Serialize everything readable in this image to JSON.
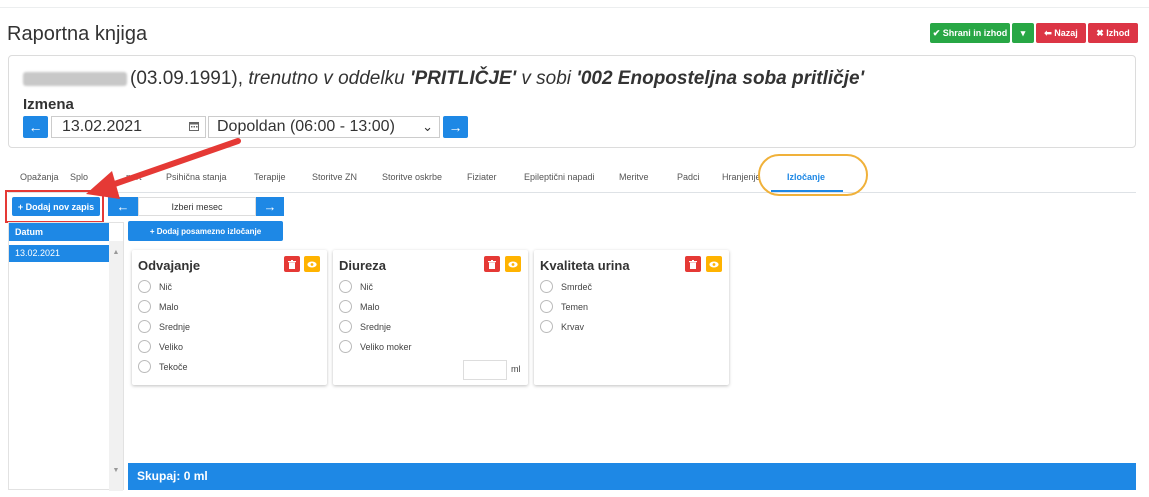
{
  "header": {
    "title": "Raportna knjiga",
    "save_exit_label": "✔ Shrani in izhod",
    "save_caret": "▾",
    "back_label": "⬅ Nazaj",
    "exit_label": "✖ Izhod"
  },
  "patient": {
    "birth": "(03.09.1991),",
    "text1": "trenutno v oddelku",
    "ward": "'PRITLIČJE'",
    "text2": "v sobi",
    "room": "'002 Enoposteljna soba pritličje'"
  },
  "shift": {
    "label": "Izmena",
    "date": "13.02.2021",
    "period": "Dopoldan (06:00 - 13:00)",
    "prev": "←",
    "next": "→"
  },
  "tabs": [
    "Opažanja",
    "Splošno",
    "Transport",
    "Psihična stanja",
    "Terapije",
    "Storitve ZN",
    "Storitve oskrbe",
    "Fiziater",
    "Epileptični napadi",
    "Meritve",
    "Padci",
    "Hranjenje",
    "Izločanje"
  ],
  "tab_labels": {
    "t0": "Opažanja",
    "t1": "Splo",
    "t2": "port",
    "t3": "Psihična stanja",
    "t4": "Terapije",
    "t5": "Storitve ZN",
    "t6": "Storitve oskrbe",
    "t7": "Fiziater",
    "t8": "Epileptični napadi",
    "t9": "Meritve",
    "t10": "Padci",
    "t11": "Hranjenje",
    "t12": "Izločanje"
  },
  "left": {
    "add_entry": "+ Dodaj nov zapis",
    "list_header": "Datum",
    "rows": [
      "13.02.2021"
    ]
  },
  "month": {
    "prev": "←",
    "label": "Izberi mesec",
    "next": "→"
  },
  "add_single": "+ Dodaj posamezno izločanje",
  "cards": {
    "odvajanje": {
      "title": "Odvajanje",
      "options": [
        "Nič",
        "Malo",
        "Srednje",
        "Veliko",
        "Tekoče"
      ]
    },
    "diureza": {
      "title": "Diureza",
      "options": [
        "Nič",
        "Malo",
        "Srednje",
        "Veliko moker"
      ],
      "unit": "ml"
    },
    "kvaliteta": {
      "title": "Kvaliteta urina",
      "options": [
        "Smrdeč",
        "Temen",
        "Krvav"
      ]
    }
  },
  "total": {
    "label": "Skupaj:",
    "value": "0 ml"
  },
  "colors": {
    "primary": "#1e88e5",
    "success": "#28a745",
    "danger": "#dc3545",
    "warning": "#ffb300",
    "highlight": "#f0b13a",
    "arrow": "#e53935"
  },
  "icons": {
    "delete": "trash-icon",
    "view": "eye-icon",
    "calendar": "calendar-icon"
  }
}
